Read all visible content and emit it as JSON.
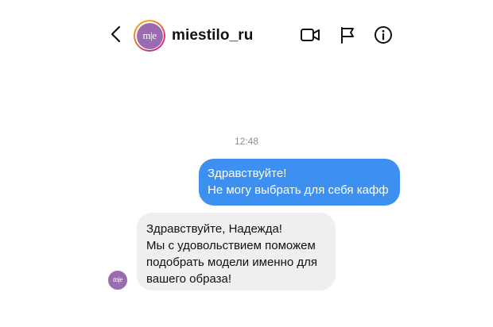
{
  "header": {
    "username": "miestilo_ru",
    "avatar_monogram": "m|e",
    "icons": {
      "back": "chevron-left-icon",
      "video": "video-camera-icon",
      "report": "flag-icon",
      "info": "info-icon"
    }
  },
  "conversation": {
    "timestamp": "12:48",
    "messages": [
      {
        "direction": "outgoing",
        "lines": [
          "Здравствуйте!",
          "Не могу выбрать для себя кафф"
        ]
      },
      {
        "direction": "incoming",
        "lines": [
          "Здравствуйте, Надежда!",
          "Мы с удовольствием поможем",
          "подобрать модели именно для",
          "вашего образа!"
        ]
      }
    ]
  },
  "colors": {
    "outgoing_bubble": "#3d8ff0",
    "incoming_bubble": "#efefef",
    "avatar": "#9a6bb0",
    "timestamp_text": "#8e8e8e"
  }
}
